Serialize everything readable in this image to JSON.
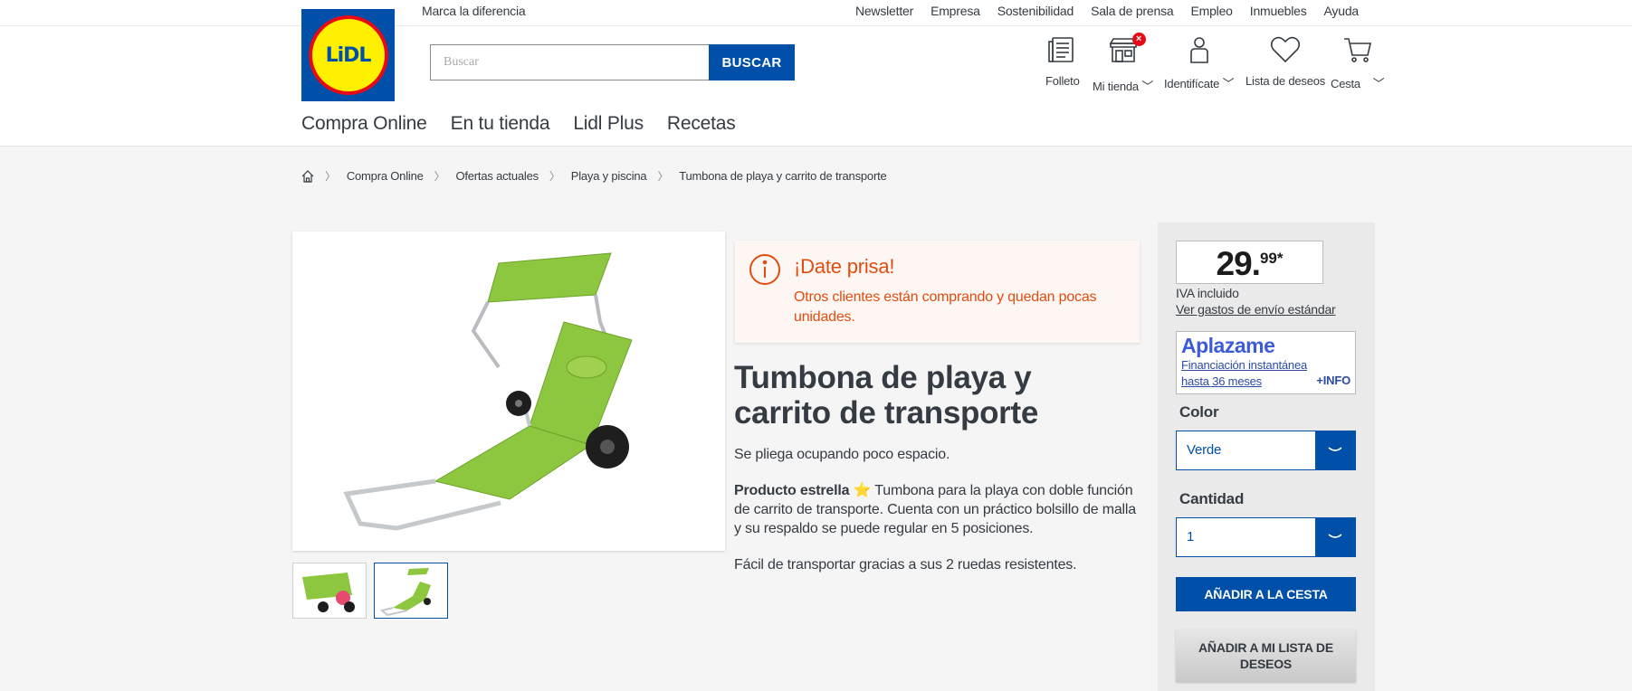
{
  "header": {
    "logo_text": "LiDL",
    "tagline": "Marca la diferencia",
    "top_links": [
      "Newsletter",
      "Empresa",
      "Sostenibilidad",
      "Sala de prensa",
      "Empleo",
      "Inmuebles",
      "Ayuda"
    ],
    "search": {
      "placeholder": "Buscar",
      "button_label": "BUSCAR"
    },
    "icons": {
      "folleto": "Folleto",
      "tienda": "Mi tienda",
      "tienda_badge": "×",
      "identificate": "Identifícate",
      "deseos": "Lista de deseos",
      "cesta": "Cesta"
    },
    "nav": [
      "Compra Online",
      "En tu tienda",
      "Lidl Plus",
      "Recetas"
    ]
  },
  "breadcrumb": [
    "Compra Online",
    "Ofertas actuales",
    "Playa y piscina",
    "Tumbona de playa y carrito de transporte"
  ],
  "alert": {
    "title": "¡Date prisa!",
    "text": "Otros clientes están comprando y quedan pocas unidades."
  },
  "product": {
    "title": "Tumbona de playa y carrito de transporte",
    "short_desc": "Se pliega ocupando poco espacio.",
    "star_label": "Producto estrella",
    "star_icon": "⭐",
    "long_desc": "Tumbona para la playa con doble función de carrito de transporte. Cuenta con un práctico bolsillo de malla y su respaldo se puede regular en 5 posiciones.",
    "extra_desc": "Fácil de transportar gracias a sus 2 ruedas resistentes."
  },
  "buybox": {
    "price_int": "29.",
    "price_dec": "99*",
    "iva": "IVA incluido",
    "shipping": "Ver gastos de envío estándar",
    "aplazame_logo": "Aplazame",
    "aplazame_text": "Financiación instantánea hasta 36 meses",
    "aplazame_info": "+INFO",
    "color_label": "Color",
    "color_value": "Verde",
    "qty_label": "Cantidad",
    "qty_value": "1",
    "add_cart": "AÑADIR A LA CESTA",
    "add_wishlist": "AÑADIR A MI LISTA DE DESEOS"
  },
  "colors": {
    "brand_blue": "#0050aa",
    "alert_orange": "#e04d10",
    "product_green": "#8dc63f"
  }
}
